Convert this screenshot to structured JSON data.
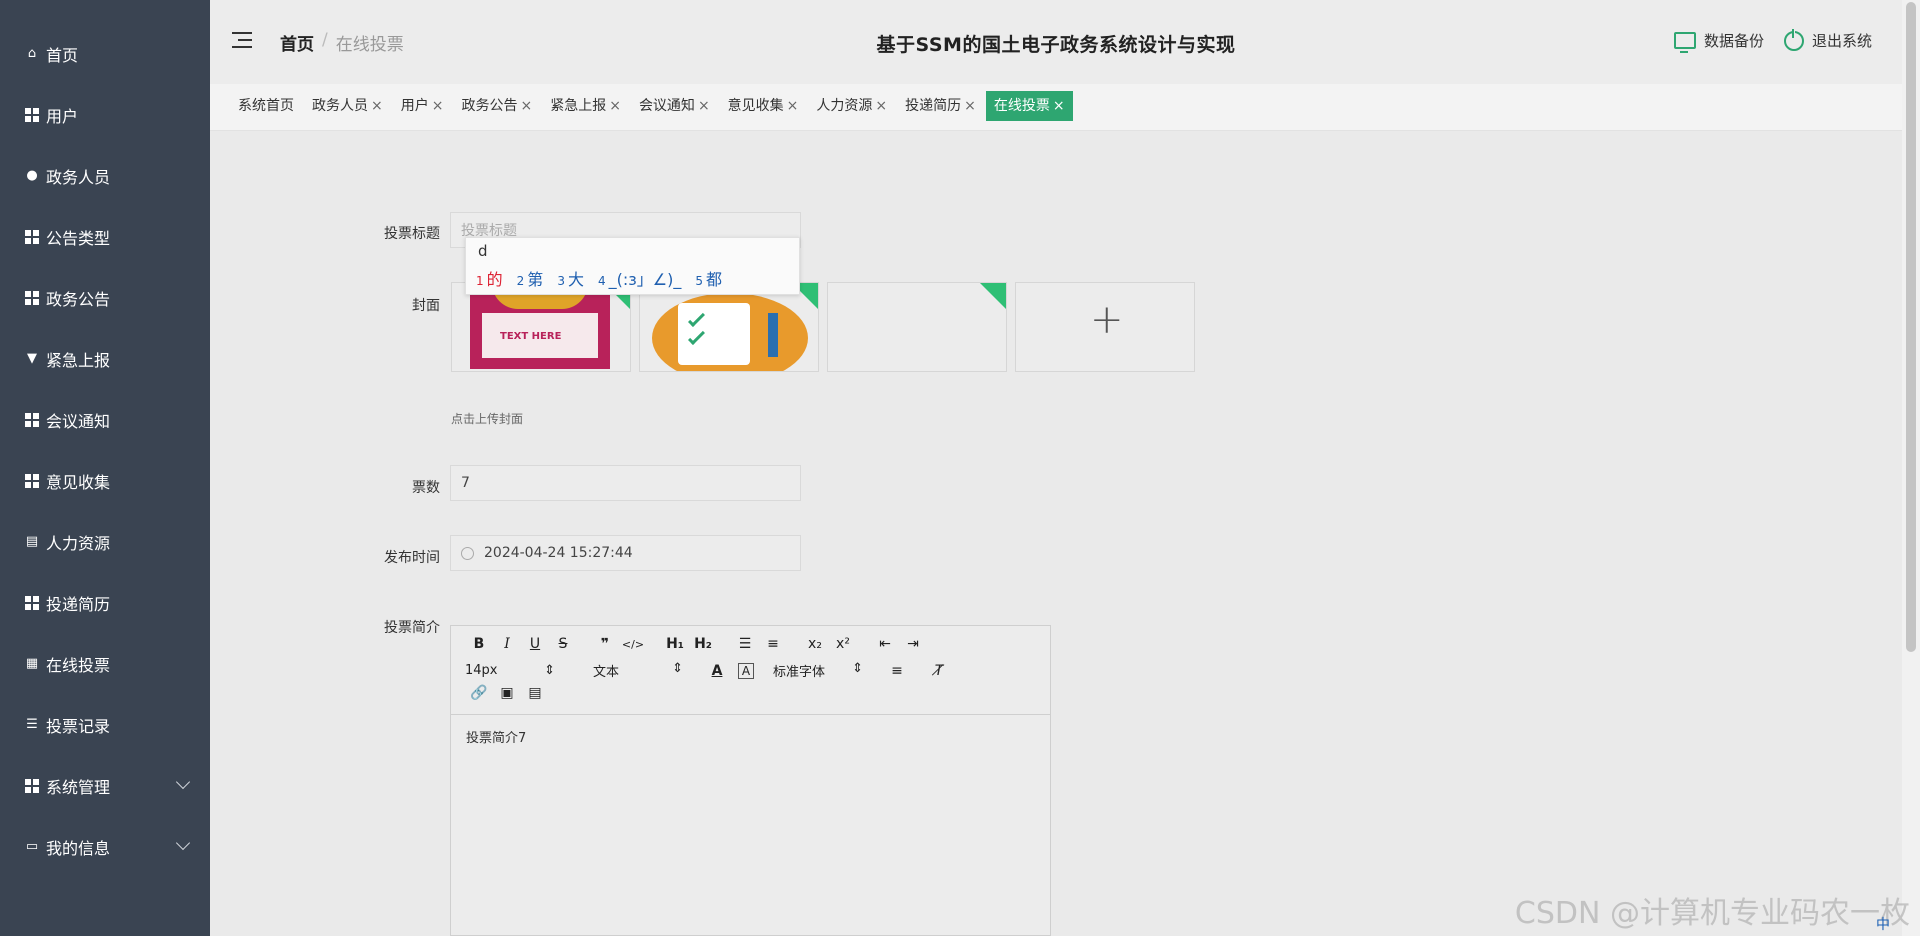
{
  "sidebar": {
    "items": [
      {
        "label": "首页",
        "icon": "home-icon"
      },
      {
        "label": "用户",
        "icon": "grid-icon"
      },
      {
        "label": "政务人员",
        "icon": "bulb-icon"
      },
      {
        "label": "公告类型",
        "icon": "grid-icon"
      },
      {
        "label": "政务公告",
        "icon": "grid-icon"
      },
      {
        "label": "紧急上报",
        "icon": "pin-icon"
      },
      {
        "label": "会议通知",
        "icon": "grid-icon"
      },
      {
        "label": "意见收集",
        "icon": "grid-icon"
      },
      {
        "label": "人力资源",
        "icon": "clipboard-icon"
      },
      {
        "label": "投递简历",
        "icon": "grid-icon"
      },
      {
        "label": "在线投票",
        "icon": "table-icon"
      },
      {
        "label": "投票记录",
        "icon": "list-icon"
      },
      {
        "label": "系统管理",
        "icon": "grid-icon",
        "expandable": true
      },
      {
        "label": "我的信息",
        "icon": "card-icon",
        "expandable": true
      }
    ]
  },
  "header": {
    "breadcrumb_home": "首页",
    "breadcrumb_sep": "/",
    "breadcrumb_current": "在线投票",
    "title": "基于SSM的国土电子政务系统设计与实现",
    "backup_label": "数据备份",
    "logout_label": "退出系统"
  },
  "tabs": [
    {
      "label": "系统首页",
      "closable": false,
      "active": false
    },
    {
      "label": "政务人员",
      "closable": true,
      "active": false
    },
    {
      "label": "用户",
      "closable": true,
      "active": false
    },
    {
      "label": "政务公告",
      "closable": true,
      "active": false
    },
    {
      "label": "紧急上报",
      "closable": true,
      "active": false
    },
    {
      "label": "会议通知",
      "closable": true,
      "active": false
    },
    {
      "label": "意见收集",
      "closable": true,
      "active": false
    },
    {
      "label": "人力资源",
      "closable": true,
      "active": false
    },
    {
      "label": "投递简历",
      "closable": true,
      "active": false
    },
    {
      "label": "在线投票",
      "closable": true,
      "active": true
    }
  ],
  "tab_close_glyph": "×",
  "form": {
    "title_label": "投票标题",
    "title_placeholder": "投票标题",
    "cover_label": "封面",
    "cover_hint": "点击上传封面",
    "cover_thumb1_text": "TEXT HERE",
    "votes_label": "票数",
    "votes_value": "7",
    "publish_label": "发布时间",
    "publish_value": "2024-04-24 15:27:44",
    "intro_label": "投票简介",
    "intro_value": "投票简介7"
  },
  "ime": {
    "typed": "d",
    "candidates": [
      {
        "n": "1",
        "text": "的"
      },
      {
        "n": "2",
        "text": "第"
      },
      {
        "n": "3",
        "text": "大"
      },
      {
        "n": "4",
        "text": "_(:з」∠)_"
      },
      {
        "n": "5",
        "text": "都"
      }
    ]
  },
  "editor": {
    "font_size": "14px",
    "block_type": "文本",
    "font_family": "标准字体"
  },
  "watermark": "CSDN @计算机专业码农一枚",
  "tray_ime_mode": "中",
  "colors": {
    "accent": "#2ea671",
    "sidebar": "#3a4452"
  }
}
